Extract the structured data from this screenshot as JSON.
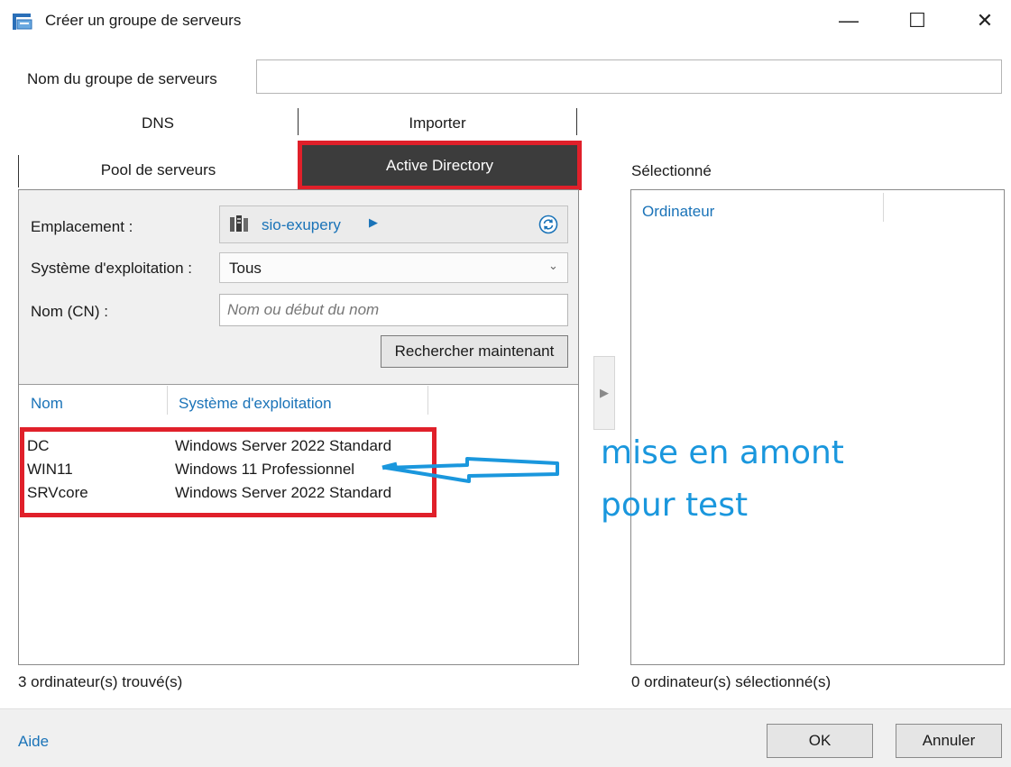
{
  "window": {
    "title": "Créer un groupe de serveurs",
    "minimize": "—",
    "maximize": "☐",
    "close": "✕"
  },
  "group_name": {
    "label": "Nom du groupe de serveurs",
    "value": ""
  },
  "tabs": {
    "row1": [
      "DNS",
      "Importer"
    ],
    "row2": [
      "Pool de serveurs",
      "Active Directory"
    ],
    "active": "Active Directory"
  },
  "filters": {
    "location_label": "Emplacement :",
    "location_value": "sio-exupery",
    "os_label": "Système d'exploitation :",
    "os_value": "Tous",
    "cn_label": "Nom (CN) :",
    "cn_placeholder": "Nom ou début du nom",
    "search_button": "Rechercher maintenant"
  },
  "results": {
    "columns": [
      "Nom",
      "Système d'exploitation"
    ],
    "rows": [
      {
        "name": "DC",
        "os": "Windows Server 2022 Standard"
      },
      {
        "name": "WIN11",
        "os": "Windows 11 Professionnel"
      },
      {
        "name": "SRVcore",
        "os": "Windows Server 2022 Standard"
      }
    ],
    "count_text": "3 ordinateur(s) trouvé(s)"
  },
  "selected": {
    "heading": "Sélectionné",
    "column": "Ordinateur",
    "count_text": "0 ordinateur(s) sélectionné(s)"
  },
  "annotation": {
    "line1": "mise en amont",
    "line2": "pour test",
    "color": "#1a97dd"
  },
  "footer": {
    "help": "Aide",
    "ok": "OK",
    "cancel": "Annuler"
  },
  "colors": {
    "highlight": "#e0202a",
    "link": "#1a73b8",
    "active_tab": "#3c3c3c"
  }
}
